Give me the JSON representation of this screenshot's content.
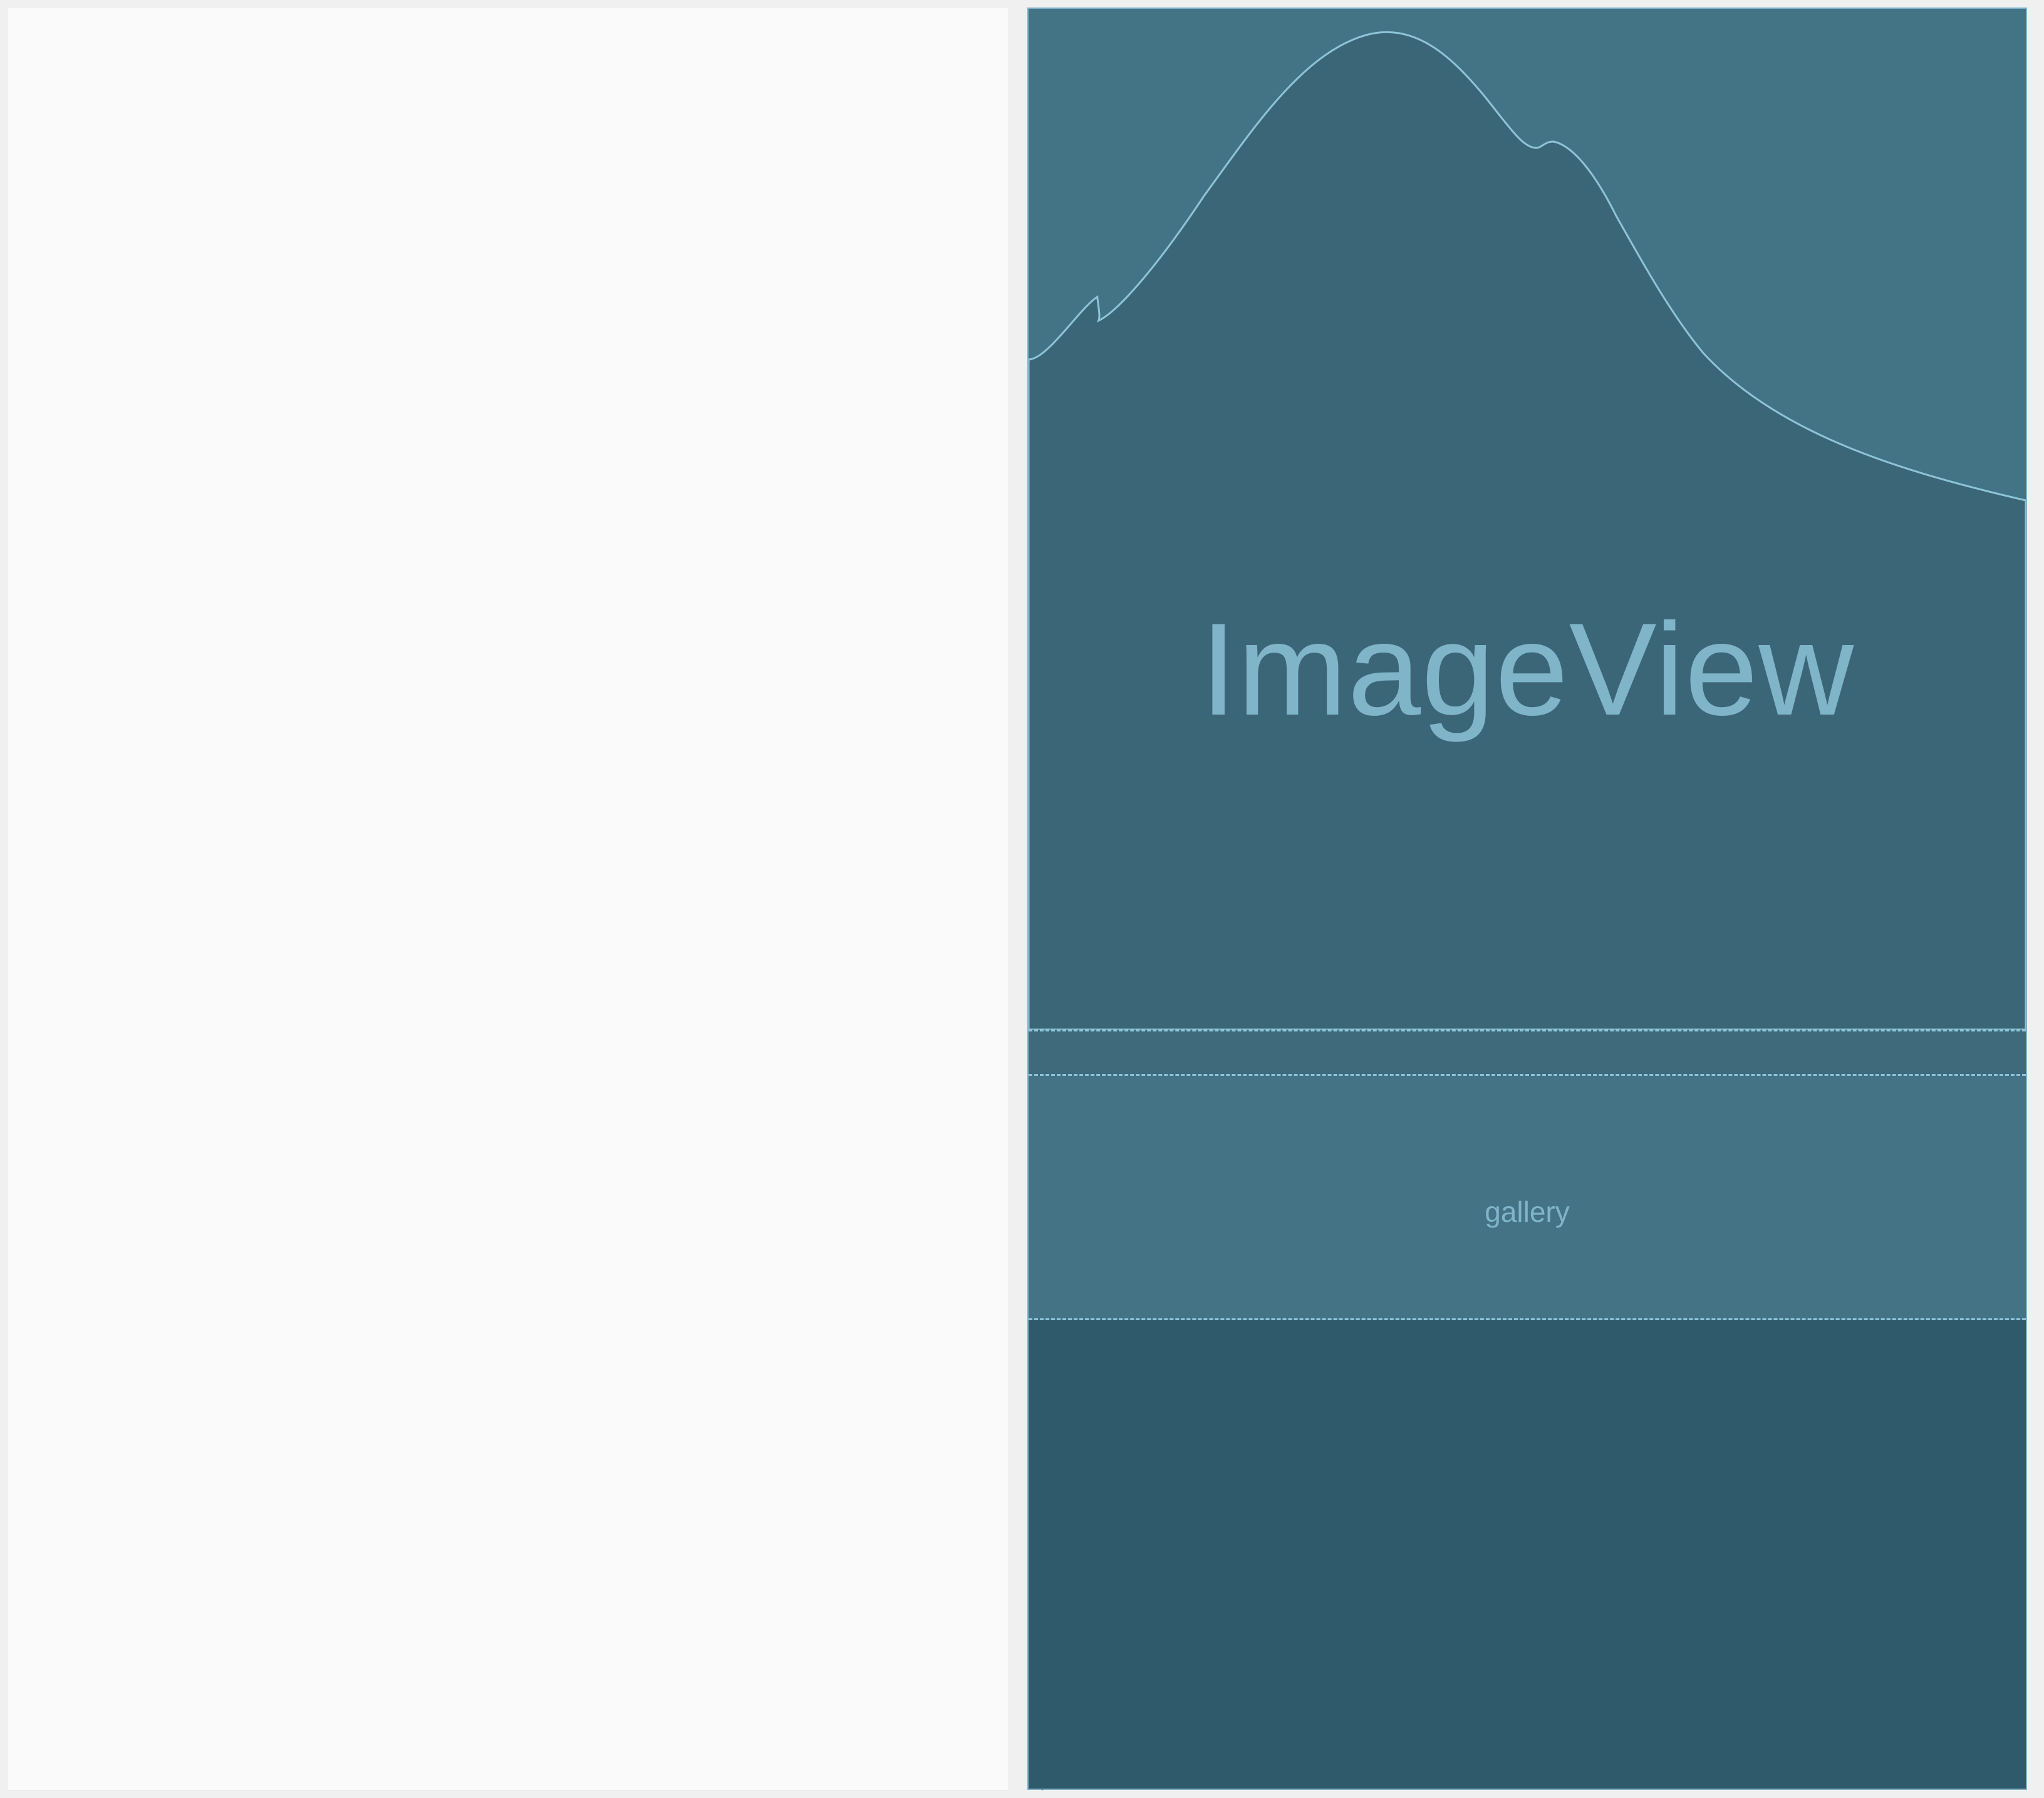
{
  "design_pane": {
    "label": ""
  },
  "blueprint": {
    "imageview_label": "ImageView",
    "gallery_label": "gallery"
  },
  "colors": {
    "background": "#f0f0f0",
    "design_surface": "#fafafa",
    "blueprint_base": "#2f5a6c",
    "blueprint_view": "#437485",
    "blueprint_outline": "#7fb2c8",
    "blueprint_text": "#7fb4c9"
  }
}
